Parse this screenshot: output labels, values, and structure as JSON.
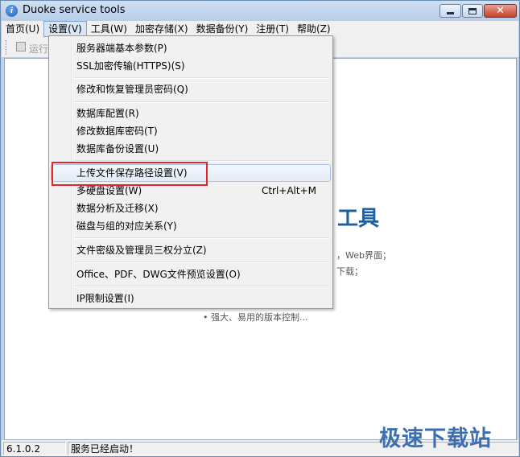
{
  "window": {
    "title": "Duoke service tools",
    "close_glyph": "✕"
  },
  "menubar": [
    {
      "label": "首页(U)"
    },
    {
      "label": "设置(V)"
    },
    {
      "label": "工具(W)"
    },
    {
      "label": "加密存储(X)"
    },
    {
      "label": "数据备份(Y)"
    },
    {
      "label": "注册(T)"
    },
    {
      "label": "帮助(Z)"
    }
  ],
  "toolbar": {
    "run_label": "运行"
  },
  "settings_menu": {
    "items": [
      {
        "label": "服务器端基本参数(P)",
        "shortcut": ""
      },
      {
        "label": "SSL加密传输(HTTPS)(S)",
        "shortcut": ""
      },
      {
        "label": "修改和恢复管理员密码(Q)",
        "shortcut": ""
      },
      {
        "label": "数据库配置(R)",
        "shortcut": ""
      },
      {
        "label": "修改数据库密码(T)",
        "shortcut": ""
      },
      {
        "label": "数据库备份设置(U)",
        "shortcut": ""
      },
      {
        "label": "上传文件保存路径设置(V)",
        "shortcut": ""
      },
      {
        "label": "多硬盘设置(W)",
        "shortcut": "Ctrl+Alt+M"
      },
      {
        "label": "数据分析及迁移(X)",
        "shortcut": ""
      },
      {
        "label": "磁盘与组的对应关系(Y)",
        "shortcut": ""
      },
      {
        "label": "文件密级及管理员三权分立(Z)",
        "shortcut": ""
      },
      {
        "label": "Office、PDF、DWG文件预览设置(O)",
        "shortcut": ""
      },
      {
        "label": "IP限制设置(I)",
        "shortcut": ""
      }
    ]
  },
  "splash": {
    "title": "工具",
    "line1": "，Web界面；",
    "line2": "下载；",
    "line3": "• 强大、易用的版本控制..."
  },
  "statusbar": {
    "version": "6.1.0.2",
    "message": "服务已经启动！"
  },
  "watermark": "极速下载站",
  "colors": {
    "highlight_box": "#e0262a",
    "splash_title": "#1f5f9e"
  }
}
